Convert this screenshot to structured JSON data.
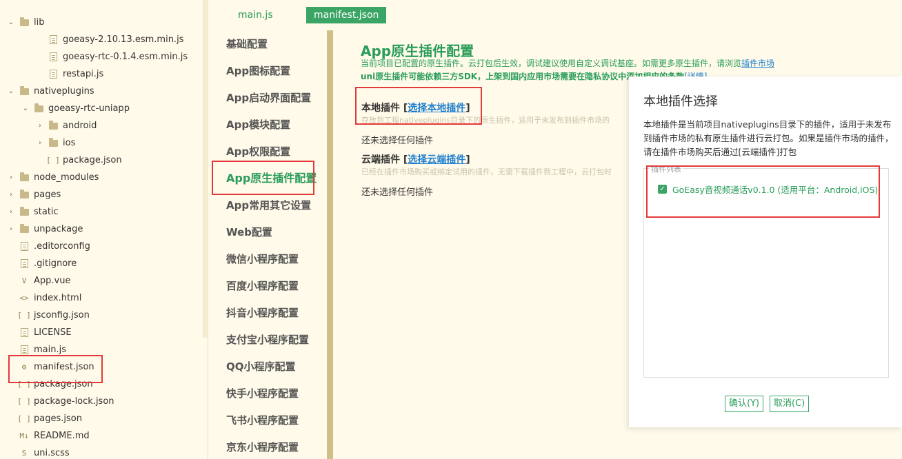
{
  "file_tree": [
    {
      "label": "lib",
      "type": "folder",
      "expanded": true
    },
    {
      "label": "goeasy-2.10.13.esm.min.js",
      "type": "js"
    },
    {
      "label": "goeasy-rtc-0.1.4.esm.min.js",
      "type": "js"
    },
    {
      "label": "restapi.js",
      "type": "js"
    },
    {
      "label": "nativeplugins",
      "type": "folder",
      "expanded": true
    },
    {
      "label": "goeasy-rtc-uniapp",
      "type": "folder",
      "expanded": true
    },
    {
      "label": "android",
      "type": "folder",
      "expanded": false
    },
    {
      "label": "ios",
      "type": "folder",
      "expanded": false
    },
    {
      "label": "package.json",
      "type": "json"
    },
    {
      "label": "node_modules",
      "type": "folder",
      "expanded": false
    },
    {
      "label": "pages",
      "type": "folder",
      "expanded": false
    },
    {
      "label": "static",
      "type": "folder",
      "expanded": false
    },
    {
      "label": "unpackage",
      "type": "folder",
      "expanded": false
    },
    {
      "label": ".editorconfig",
      "type": "file"
    },
    {
      "label": ".gitignore",
      "type": "file"
    },
    {
      "label": "App.vue",
      "type": "vue"
    },
    {
      "label": "index.html",
      "type": "html"
    },
    {
      "label": "jsconfig.json",
      "type": "json"
    },
    {
      "label": "LICENSE",
      "type": "file"
    },
    {
      "label": "main.js",
      "type": "js"
    },
    {
      "label": "manifest.json",
      "type": "manifest"
    },
    {
      "label": "package.json",
      "type": "json"
    },
    {
      "label": "package-lock.json",
      "type": "json"
    },
    {
      "label": "pages.json",
      "type": "json"
    },
    {
      "label": "README.md",
      "type": "md"
    },
    {
      "label": "uni.scss",
      "type": "scss"
    }
  ],
  "tabs": {
    "main": "main.js",
    "manifest": "manifest.json"
  },
  "nav": [
    "基础配置",
    "App图标配置",
    "App启动界面配置",
    "App模块配置",
    "App权限配置",
    "App原生插件配置",
    "App常用其它设置",
    "Web配置",
    "微信小程序配置",
    "百度小程序配置",
    "抖音小程序配置",
    "支付宝小程序配置",
    "QQ小程序配置",
    "快手小程序配置",
    "飞书小程序配置",
    "京东小程序配置"
  ],
  "content": {
    "title": "App原生插件配置",
    "desc1_text": "当前项目已配置的原生插件。云打包后生效，调试建议使用自定义调试基座。如需更多原生插件，请浏览",
    "desc1_link": "插件市场",
    "desc2_text": "uni原生插件可能依赖三方SDK，上架到国内应用市场需要在隐私协议中添加相应的条款",
    "desc2_link": "[详情]",
    "local_title": "本地插件",
    "local_link": "选择本地插件",
    "local_hint": "存放到工程nativeplugins目录下的原生插件，适用于未发布到插件市场的",
    "local_empty": "还未选择任何插件",
    "cloud_title": "云端插件",
    "cloud_link": "选择云端插件",
    "cloud_hint": "已经在插件市场购买或绑定试用的插件，无需下载插件到工程中，云打包时",
    "cloud_empty": "还未选择任何插件"
  },
  "dialog": {
    "title": "本地插件选择",
    "description": "本地插件是当前项目nativeplugins目录下的插件，适用于未发布到插件市场的私有原生插件进行云打包。如果是插件市场的插件，请在插件市场购买后通过[云端插件]打包",
    "group_label": "插件列表",
    "plugin_label": "GoEasy音视频通话v0.1.0 (适用平台：Android,iOS)",
    "plugin_checked": true,
    "ok": "确认(Y)",
    "cancel": "取消(C)"
  }
}
